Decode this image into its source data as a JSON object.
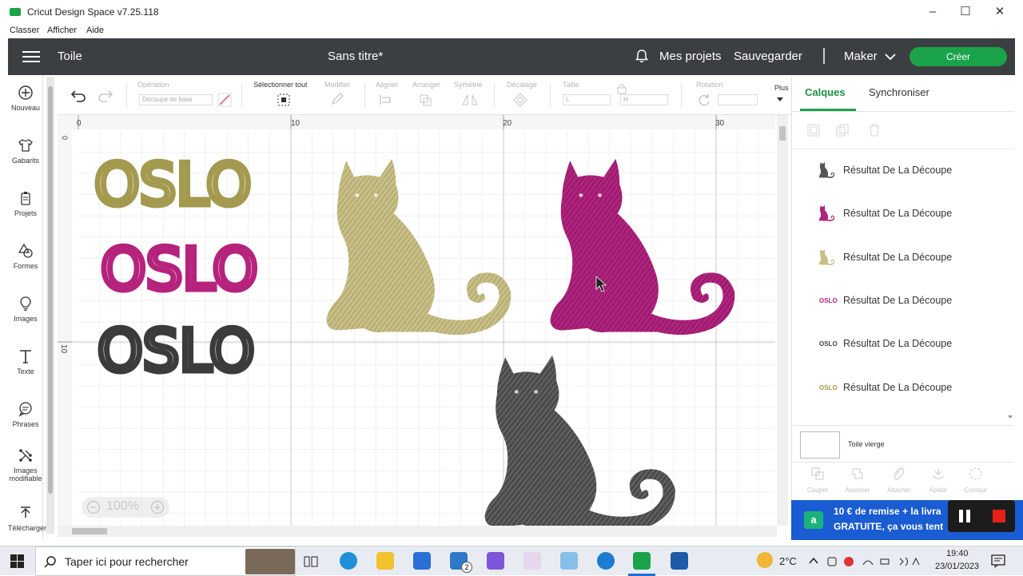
{
  "window": {
    "title": "Cricut Design Space  v7.25.118"
  },
  "menu": {
    "items": [
      "Classer",
      "Afficher",
      "Aide"
    ]
  },
  "header": {
    "canvas_label": "Toile",
    "project_title": "Sans titre*",
    "my_projects": "Mes projets",
    "save": "Sauvegarder",
    "machine": "Maker",
    "create": "Créer"
  },
  "sidebar": {
    "items": [
      {
        "label": "Nouveau",
        "icon": "plus-icon"
      },
      {
        "label": "Gabarits",
        "icon": "shirt-icon"
      },
      {
        "label": "Projets",
        "icon": "projects-icon"
      },
      {
        "label": "Formes",
        "icon": "shapes-icon"
      },
      {
        "label": "Images",
        "icon": "bulb-icon"
      },
      {
        "label": "Texte",
        "icon": "text-icon"
      },
      {
        "label": "Phrases",
        "icon": "speech-bubble-icon"
      },
      {
        "label": "Images modifiable",
        "icon": "editable-image-icon"
      },
      {
        "label": "Télécharger",
        "icon": "upload-icon"
      }
    ]
  },
  "toolbar": {
    "operation": "Opération",
    "operation_value": "Découpe de base",
    "select_all": "Sélectionner tout",
    "modify": "Modifier",
    "align": "Aligner",
    "arrange": "Arranger",
    "symmetry": "Symétrie",
    "offset": "Décalage",
    "size": "Taille",
    "size_w": "L",
    "size_h": "H",
    "rotation": "Rotation",
    "more": "Plus"
  },
  "canvas": {
    "ruler_top": [
      "0",
      "10",
      "20",
      "30"
    ],
    "ruler_left": [
      "0",
      "10"
    ],
    "texts": [
      {
        "text": "OSLO",
        "color": "#a39a4f"
      },
      {
        "text": "OSLO",
        "color": "#b5237d"
      },
      {
        "text": "OSLO",
        "color": "#3b3b3b"
      }
    ],
    "cat_colors": {
      "gold": "#c8bf86",
      "pink": "#b0237e",
      "dark": "#4a4a4a"
    },
    "zoom": "100%"
  },
  "right_panel": {
    "tabs": [
      "Calques",
      "Synchroniser"
    ],
    "layers": [
      {
        "name": "Résultat De La Découpe",
        "thumb": "cat",
        "color": "#555555"
      },
      {
        "name": "Résultat De La Découpe",
        "thumb": "cat",
        "color": "#b0237e"
      },
      {
        "name": "Résultat De La Découpe",
        "thumb": "cat",
        "color": "#c8bf86"
      },
      {
        "name": "Résultat De La Découpe",
        "thumb": "text",
        "text": "OSLO",
        "color": "#b5237d"
      },
      {
        "name": "Résultat De La Découpe",
        "thumb": "text",
        "text": "OSLO",
        "color": "#444444"
      },
      {
        "name": "Résultat De La Découpe",
        "thumb": "text",
        "text": "OSLO",
        "color": "#a39a4f"
      }
    ],
    "blank_canvas": "Toile vierge",
    "bottom_actions": [
      "Couper",
      "Associer",
      "Attacher",
      "Aplatir",
      "Contour"
    ]
  },
  "ad": {
    "line1": "10 € de remise + la livra",
    "line2": "GRATUITE, ça vous tent",
    "badge": "a"
  },
  "taskbar": {
    "search_placeholder": "Taper ici pour rechercher",
    "temperature": "2°C",
    "time": "19:40",
    "date": "23/01/2023",
    "mail_badge": "2"
  }
}
